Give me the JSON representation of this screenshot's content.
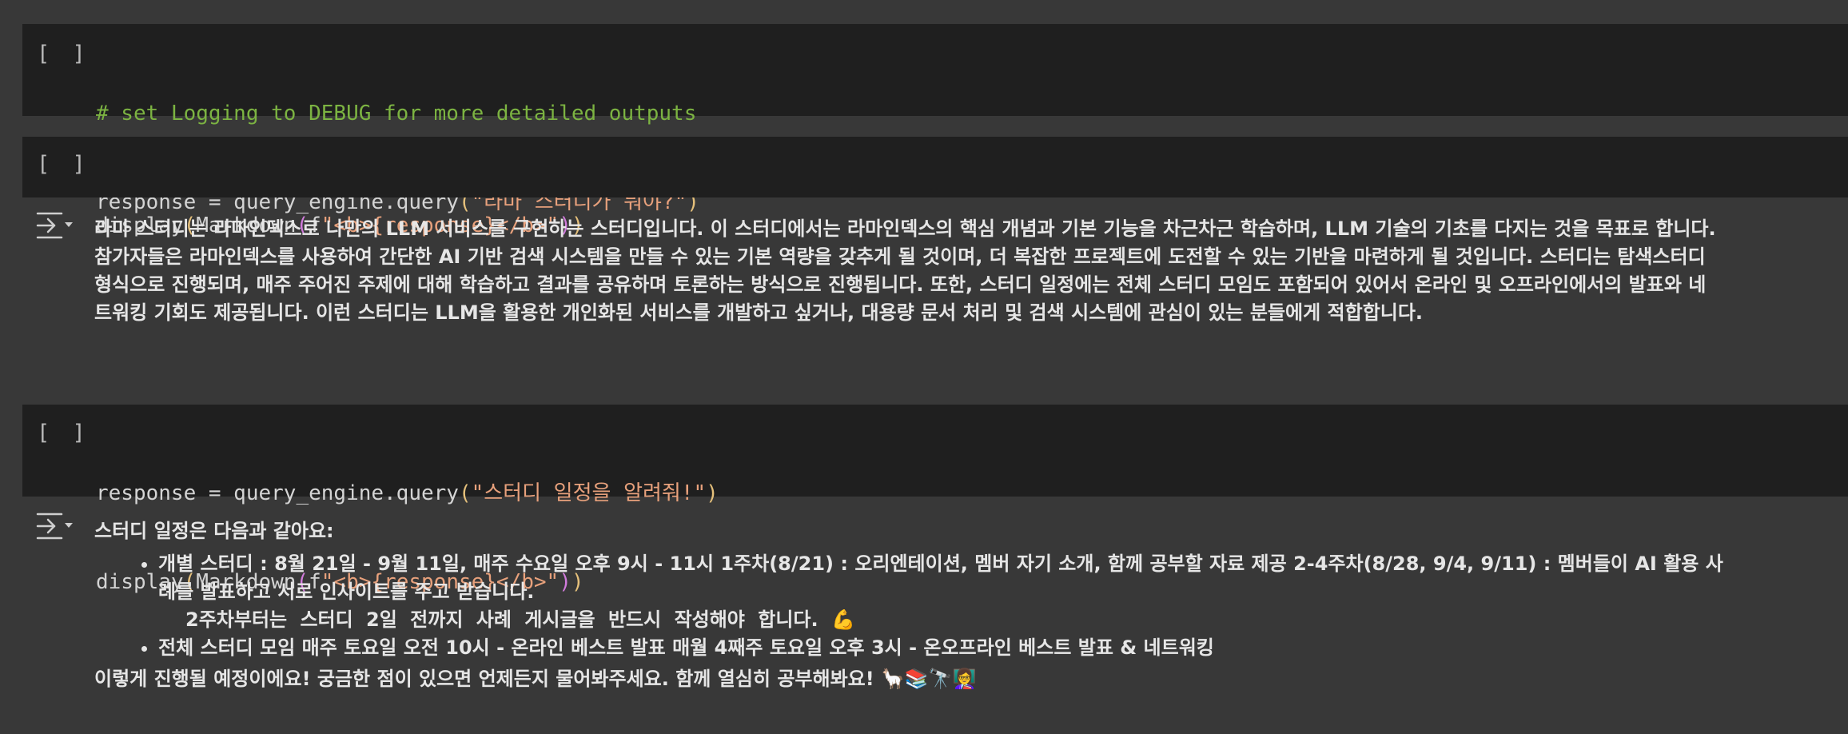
{
  "cells": {
    "c1": {
      "run_label": "[ ]",
      "line1": "# set Logging to DEBUG for more detailed outputs",
      "line2_pre": "response = query_engine.query",
      "line2_open": "(",
      "line2_str": "\"라마 스터디가 뭐야?\"",
      "line2_close": ")"
    },
    "c2": {
      "run_label": "[ ]",
      "fn": "display",
      "open1": "(",
      "mid": "Markdown",
      "open2": "(",
      "fpre": "f",
      "str": "\"<b>{response}</b>\"",
      "close2": ")",
      "close1": ")"
    },
    "out1": {
      "icon": "output-toggle-icon",
      "text": "라마 스터디는 라마인덱스로 나만의 LLM 서비스를 구현하는 스터디입니다. 이 스터디에서는 라마인덱스의 핵심 개념과 기본 기능을 차근차근 학습하며, LLM 기술의 기초를 다지는 것을 목표로 합니다. 참가자들은 라마인덱스를 사용하여 간단한 AI 기반 검색 시스템을 만들 수 있는 기본 역량을 갖추게 될 것이며, 더 복잡한 프로젝트에 도전할 수 있는 기반을 마련하게 될 것입니다. 스터디는 탐색스터디 형식으로 진행되며, 매주 주어진 주제에 대해 학습하고 결과를 공유하며 토론하는 방식으로 진행됩니다. 또한, 스터디 일정에는 전체 스터디 모임도 포함되어 있어서 온라인 및 오프라인에서의 발표와 네트워킹 기회도 제공됩니다. 이런 스터디는 LLM을 활용한 개인화된 서비스를 개발하고 싶거나, 대용량 문서 처리 및 검색 시스템에 관심이 있는 분들에게 적합합니다."
    },
    "c3": {
      "run_label": "[ ]",
      "line1_pre": "response = query_engine.query",
      "line1_open": "(",
      "line1_str": "\"스터디 일정을 알려줘!\"",
      "line1_close": ")",
      "fn": "display",
      "open1": "(",
      "mid": "Markdown",
      "open2": "(",
      "fpre": "f",
      "str": "\"<b>{response}</b>\"",
      "close2": ")",
      "close1": ")"
    },
    "out2": {
      "intro": "스터디 일정은 다음과 같아요:",
      "bullet1": "개별 스터디 : 8월 21일 - 9월 11일, 매주 수요일 오후 9시 - 11시 1주차(8/21) : 오리엔테이션, 멤버 자기 소개, 함께 공부할 자료 제공 2-4주차(8/28, 9/4, 9/11) : 멤버들이 AI 활용 사례를 발표하고 서로 인사이트를 주고 받습니다.",
      "bullet1_note": "2주차부터는 스터디 2일 전까지 사례 게시글을 반드시 작성해야 합니다. 💪",
      "bullet2": "전체 스터디 모임 매주 토요일 오전 10시 - 온라인 베스트 발표 매월 4째주 토요일 오후 3시 - 온오프라인 베스트 발표 & 네트워킹",
      "outro": "이렇게 진행될 예정이에요! 궁금한 점이 있으면 언제든지 물어봐주세요. 함께 열심히 공부해봐요! 🦙📚🔭👩‍🏫"
    }
  }
}
